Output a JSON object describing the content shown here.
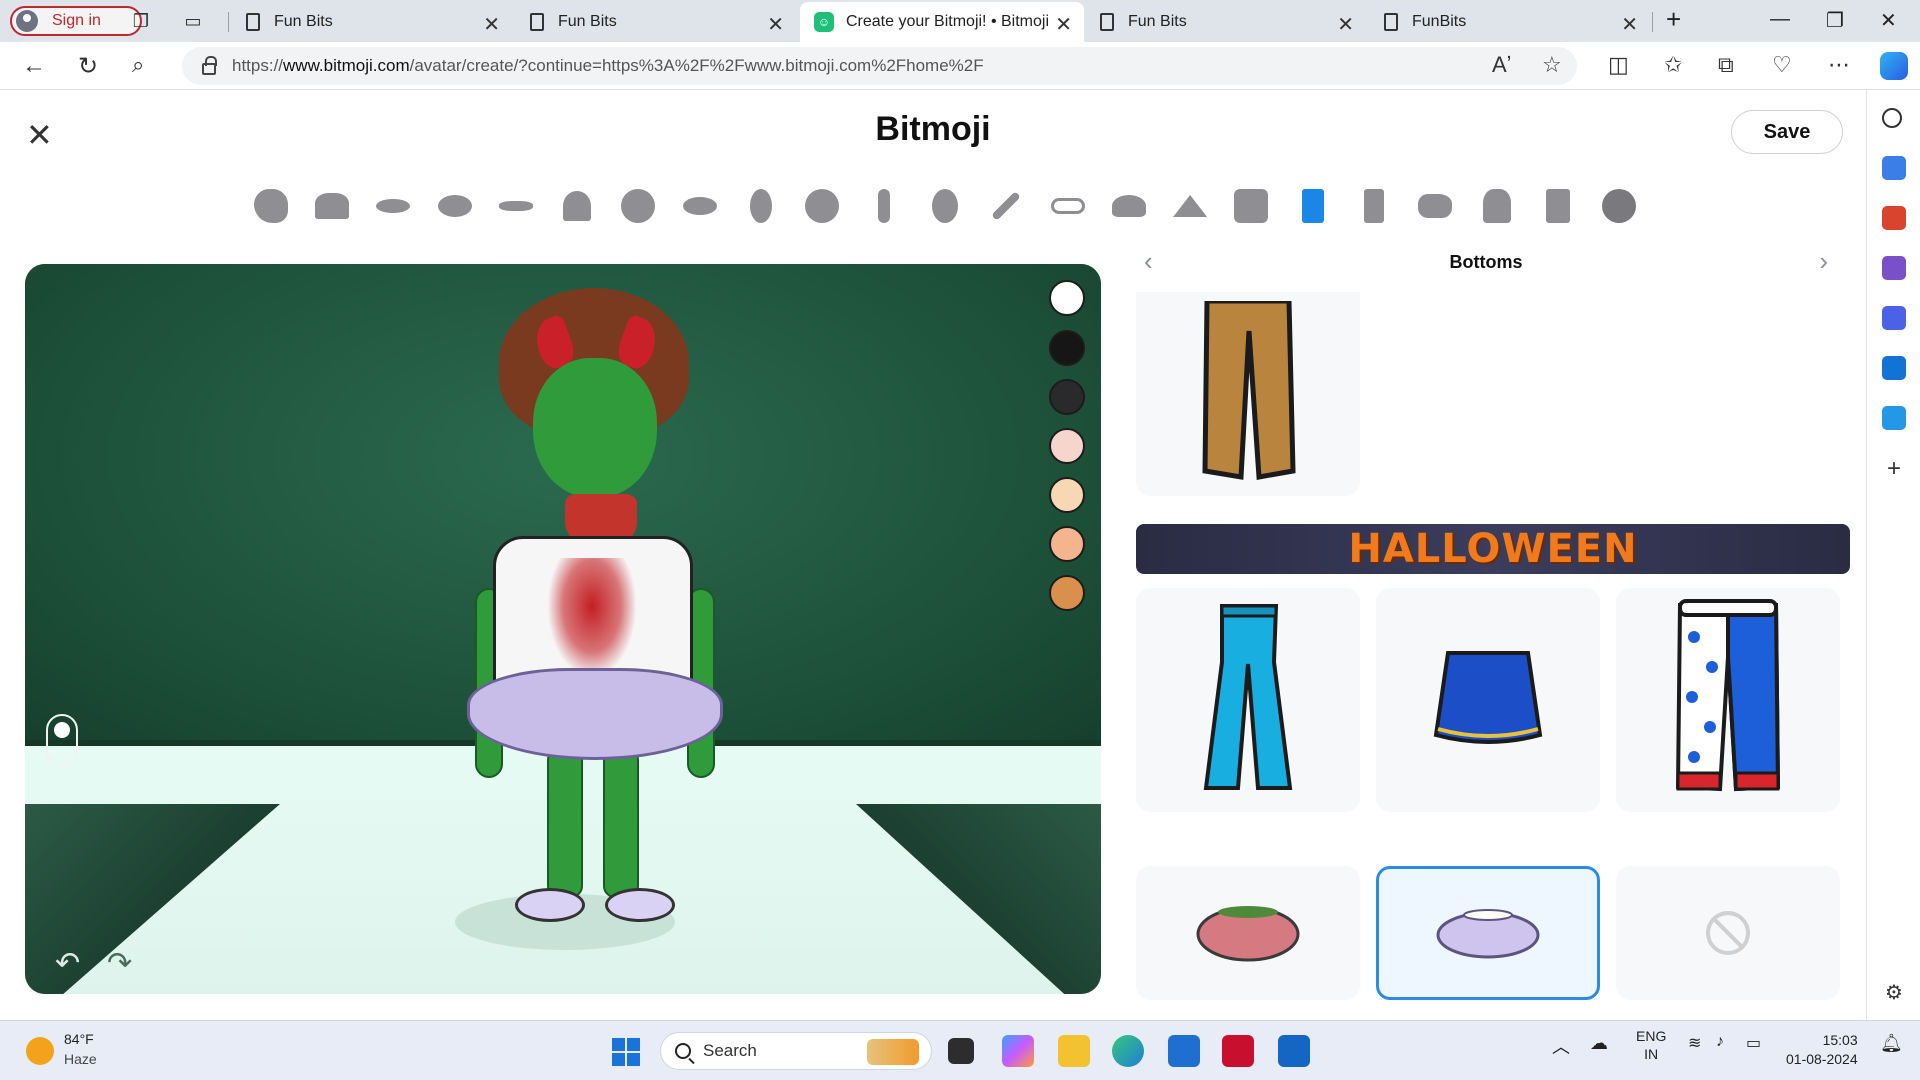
{
  "browser": {
    "signin_label": "Sign in",
    "tabs": [
      {
        "title": "Fun Bits"
      },
      {
        "title": "Fun Bits"
      },
      {
        "title": "Create your Bitmoji! • Bitmoji"
      },
      {
        "title": "Fun Bits"
      },
      {
        "title": "FunBits"
      }
    ],
    "url_prefix": "https://",
    "url_host": "www.bitmoji.com",
    "url_path": "/avatar/create/?continue=https%3A%2F%2Fwww.bitmoji.com%2Fhome%2F"
  },
  "page": {
    "title": "Bitmoji",
    "save_label": "Save",
    "categories": [
      "face-shape",
      "hair",
      "facial-hair",
      "eyes",
      "eyebrows",
      "nose",
      "face-detail",
      "mouth",
      "ears",
      "face-lines",
      "body",
      "makeup",
      "makeup-brush",
      "glasses",
      "headwear",
      "outfits",
      "tops",
      "bottoms",
      "one-piece",
      "shoes",
      "outerwear",
      "socks",
      "done"
    ],
    "active_category": "bottoms",
    "skin_swatches": [
      "#ffffff",
      "#161616",
      "#2a2a2c",
      "#f6d6cc",
      "#f8d7b4",
      "#f4b48e",
      "#d8904c"
    ]
  },
  "panel": {
    "title": "Bottoms",
    "banner": "HALLOWEEN",
    "items": [
      {
        "name": "brown-pants"
      },
      {
        "name": "blue-flare-pants"
      },
      {
        "name": "blue-skirt"
      },
      {
        "name": "polka-dot-clown-pants"
      },
      {
        "name": "pink-flower-tutu"
      },
      {
        "name": "lavender-tutu",
        "selected": true
      },
      {
        "name": "none"
      }
    ]
  },
  "taskbar": {
    "temperature": "84°F",
    "condition": "Haze",
    "search_label": "Search",
    "lang_top": "ENG",
    "lang_bottom": "IN",
    "time": "15:03",
    "date": "01-08-2024"
  }
}
